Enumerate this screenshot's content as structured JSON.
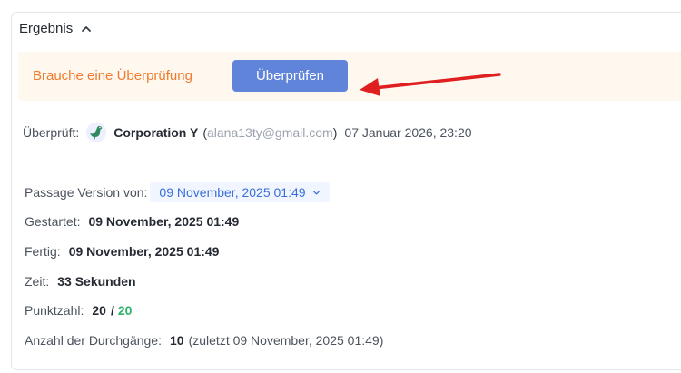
{
  "result": {
    "title": "Ergebnis",
    "banner": {
      "message": "Brauche eine Überprüfung",
      "button_label": "Überprüfen"
    },
    "verified": {
      "label": "Überprüft:",
      "name": "Corporation Y",
      "paren_open": "(",
      "email": "alana13ty@gmail.com",
      "paren_close": ")",
      "datetime": "07 Januar 2026, 23:20"
    },
    "details": {
      "version_label": "Passage Version von:",
      "version_value": "09 November, 2025 01:49",
      "started_label": "Gestartet:",
      "started_value": "09 November, 2025 01:49",
      "finished_label": "Fertig:",
      "finished_value": "09 November, 2025 01:49",
      "time_label": "Zeit:",
      "time_value": "33 Sekunden",
      "score_label": "Punktzahl:",
      "score_value": "20",
      "score_sep": "/",
      "score_max": "20",
      "attempts_label": "Anzahl der Durchgänge:",
      "attempts_value": "10",
      "attempts_note": "(zuletzt 09 November, 2025 01:49)"
    }
  },
  "colors": {
    "banner_bg": "#fff8ef",
    "banner_text": "#f07a2e",
    "button_bg": "#5f84d9",
    "link_blue": "#3a6fd8",
    "score_green": "#2db26c",
    "arrow_red": "#e02020"
  },
  "icons": {
    "collapse": "chevron-up-icon",
    "avatar": "dinosaur-icon",
    "select": "chevron-down-icon",
    "annotation": "arrow-icon"
  }
}
